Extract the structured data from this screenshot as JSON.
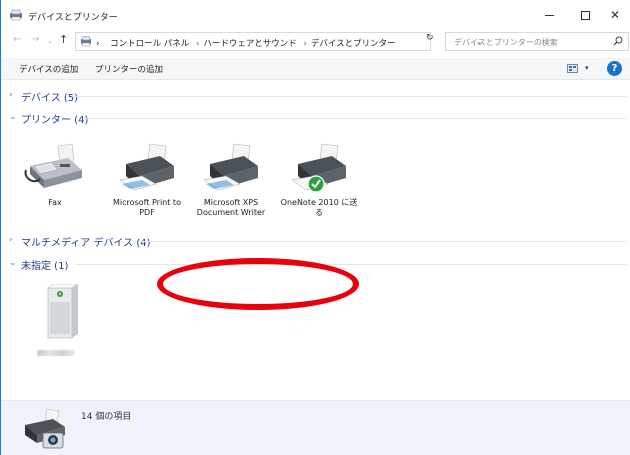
{
  "window": {
    "title": "デバイスとプリンター",
    "minimize_icon": "minimize-icon",
    "maximize_icon": "maximize-icon",
    "close_icon": "close-icon",
    "close_glyph": "✕"
  },
  "nav": {
    "back_glyph": "←",
    "forward_glyph": "→",
    "recent_glyph": "⌄",
    "up_glyph": "↑"
  },
  "address": {
    "crumbs": [
      "コントロール パネル",
      "ハードウェアとサウンド",
      "デバイスとプリンター"
    ],
    "separator": "›",
    "dropdown_glyph": "⌄",
    "refresh_glyph": "↻"
  },
  "search": {
    "placeholder": "デバイスとプリンターの検索"
  },
  "toolbar": {
    "add_device_label": "デバイスの追加",
    "add_printer_label": "プリンターの追加",
    "view_dropdown_glyph": "▾",
    "help_label": "?"
  },
  "groups": {
    "devices": {
      "label": "デバイス (5)",
      "expanded": false,
      "chevron": "›"
    },
    "printers": {
      "label": "プリンター (4)",
      "expanded": true,
      "chevron": "⌄"
    },
    "multimedia": {
      "label": "マルチメディア デバイス (4)",
      "expanded": false,
      "chevron": "›"
    },
    "unspecified": {
      "label": "未指定 (1)",
      "expanded": true,
      "chevron": "⌄"
    }
  },
  "printers": [
    {
      "name": "Fax",
      "icon": "fax-icon"
    },
    {
      "name": "Microsoft Print to PDF",
      "icon": "printer-icon"
    },
    {
      "name": "Microsoft XPS Document Writer",
      "icon": "printer-icon"
    },
    {
      "name": "OneNote 2010 に送る",
      "icon": "printer-default-icon",
      "default": true
    }
  ],
  "unspecified_items": [
    {
      "name": "",
      "icon": "computer-tower-icon",
      "blurred": true
    }
  ],
  "details": {
    "count_text": "14 個の項目",
    "icon": "printer-camera-icon"
  },
  "colors": {
    "group_title": "#1e3a8a",
    "annotation": "#e8000b",
    "details_bg": "#f0f4fa",
    "help": "#1a73c7",
    "default_check": "#2aa33b"
  }
}
